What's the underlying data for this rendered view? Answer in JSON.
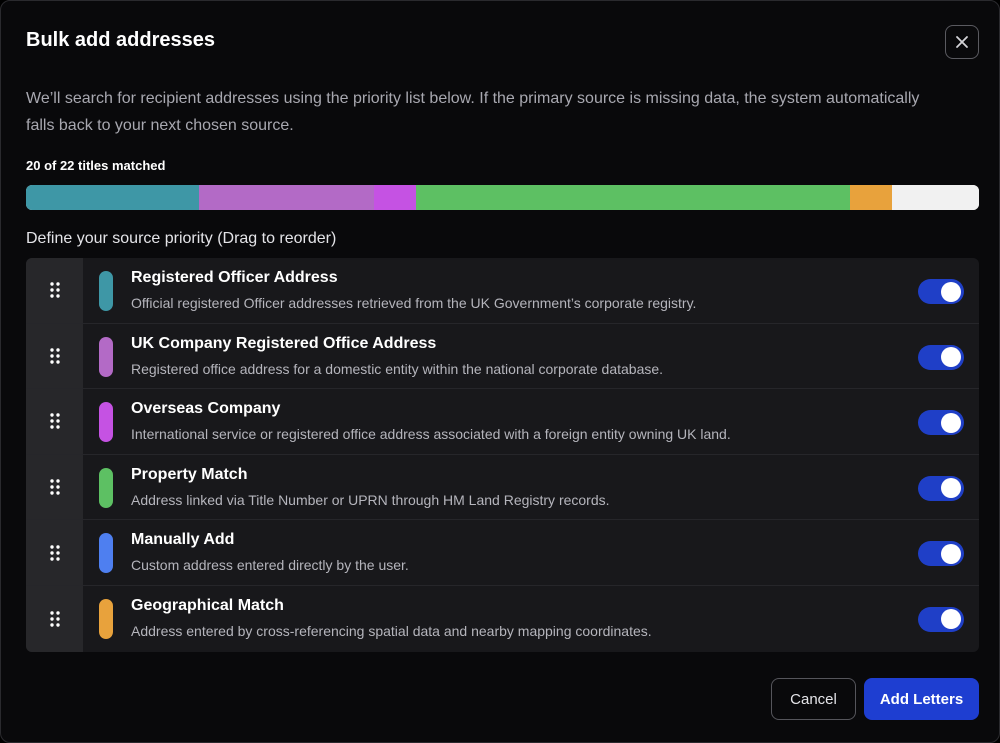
{
  "modal": {
    "title": "Bulk add addresses",
    "close_icon": "close-icon",
    "description": "We’ll search for recipient addresses using the priority list below. If the primary source is missing data, the system automatically falls back to your next chosen source."
  },
  "match": {
    "text": "20 of 22 titles matched",
    "matched": 20,
    "total": 22,
    "segments": [
      {
        "color": "#3e97a6",
        "fraction": 0.182
      },
      {
        "color": "#b36ac6",
        "fraction": 0.183
      },
      {
        "color": "#c552e3",
        "fraction": 0.044
      },
      {
        "color": "#5dc063",
        "fraction": 0.456
      },
      {
        "color": "#e8a23c",
        "fraction": 0.044
      },
      {
        "color": "#f1f1f1",
        "fraction": 0.091
      }
    ]
  },
  "priority": {
    "label": "Define your source priority (Drag to reorder)",
    "handle_icon": "drag-handle-icon",
    "sources": [
      {
        "title": "Registered Officer Address",
        "description": "Official registered Officer addresses retrieved from the UK Government’s corporate registry.",
        "color": "#3e97a6",
        "enabled": true
      },
      {
        "title": "UK Company Registered Office Address",
        "description": "Registered office address for a domestic entity within the national corporate database.",
        "color": "#b36ac6",
        "enabled": true
      },
      {
        "title": "Overseas Company",
        "description": "International service or registered office address associated with a foreign entity owning UK land.",
        "color": "#c552e3",
        "enabled": true
      },
      {
        "title": "Property Match",
        "description": "Address linked via Title Number or UPRN through HM Land Registry records.",
        "color": "#5dc063",
        "enabled": true
      },
      {
        "title": "Manually Add",
        "description": "Custom address entered directly by the user.",
        "color": "#4e7ff0",
        "enabled": true
      },
      {
        "title": "Geographical Match",
        "description": "Address entered by cross-referencing spatial data and nearby mapping coordinates.",
        "color": "#e8a23c",
        "enabled": true
      }
    ]
  },
  "footer": {
    "cancel_label": "Cancel",
    "add_label": "Add Letters",
    "accent_color": "#1e3ed1"
  }
}
